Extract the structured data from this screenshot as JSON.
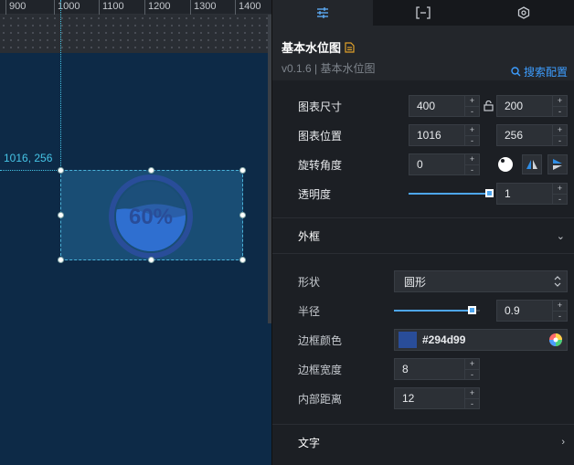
{
  "ruler": {
    "ticks": [
      "900",
      "1000",
      "1100",
      "1200",
      "1300",
      "1400"
    ]
  },
  "canvas": {
    "coord_readout": "1016, 256"
  },
  "widget": {
    "gauge_text": "60%",
    "level": 0.6
  },
  "panel": {
    "header": {
      "title": "基本水位图",
      "version": "v0.1.6 | 基本水位图",
      "search_config": "搜索配置"
    },
    "size": {
      "label": "图表尺寸",
      "width": "400",
      "height": "200"
    },
    "position": {
      "label": "图表位置",
      "x": "1016",
      "y": "256"
    },
    "rotation": {
      "label": "旋转角度",
      "value": "0"
    },
    "opacity": {
      "label": "透明度",
      "value": "1",
      "level": 1.0
    },
    "border_group": {
      "label": "外框"
    },
    "shape": {
      "label": "形状",
      "value": "圆形"
    },
    "radius": {
      "label": "半径",
      "value": "0.9",
      "level": 0.9
    },
    "border_color": {
      "label": "边框颜色",
      "value": "#294d99",
      "swatch": "#294d99"
    },
    "border_width": {
      "label": "边框宽度",
      "value": "8"
    },
    "inner_padding": {
      "label": "内部距离",
      "value": "12"
    },
    "text_group": {
      "label": "文字"
    }
  },
  "colors": {
    "accent": "#3d9dff",
    "canvas_bg": "#0d2a47",
    "panel_bg": "#1c1f24"
  }
}
